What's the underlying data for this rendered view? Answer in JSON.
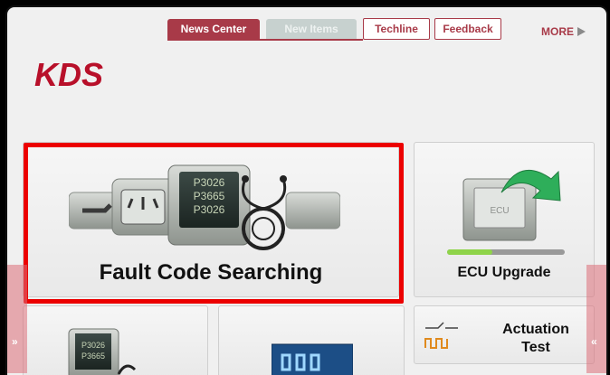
{
  "tabs": [
    {
      "label": "News Center"
    },
    {
      "label": "New Items"
    },
    {
      "label": "Techline"
    },
    {
      "label": "Feedback"
    }
  ],
  "more_label": "MORE",
  "logo_text": "KDS",
  "fault_card": {
    "label": "Fault Code Searching",
    "codes": [
      "P3026",
      "P3665",
      "P3026"
    ]
  },
  "ecu_card": {
    "label": "ECU Upgrade",
    "chip_text": "ECU"
  },
  "actuation_card": {
    "label_line1": "Actuation",
    "label_line2": "Test"
  },
  "bottom_left_codes": [
    "P3026",
    "P3665"
  ],
  "side_left": "»",
  "side_right": "«",
  "colors": {
    "accent": "#a83a48",
    "highlight": "#ec0000",
    "progress": "#8fd44a",
    "arrow": "#2eae5a"
  }
}
